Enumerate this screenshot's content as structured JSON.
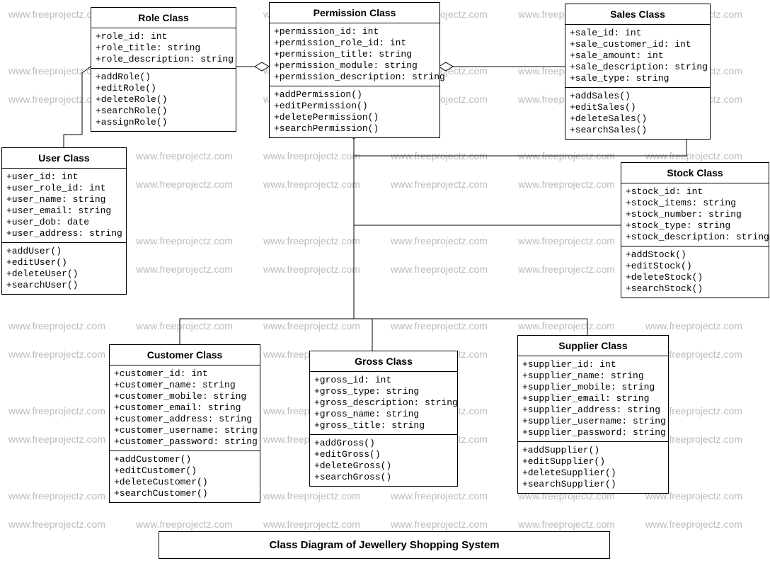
{
  "watermark": "www.freeprojectz.com",
  "caption": "Class Diagram of Jewellery Shopping System",
  "classes": {
    "role": {
      "title": "Role Class",
      "attrs": [
        "+role_id: int",
        "+role_title: string",
        "+role_description: string"
      ],
      "ops": [
        "+addRole()",
        "+editRole()",
        "+deleteRole()",
        "+searchRole()",
        "+assignRole()"
      ]
    },
    "permission": {
      "title": "Permission Class",
      "attrs": [
        "+permission_id: int",
        "+permission_role_id: int",
        "+permission_title: string",
        "+permission_module: string",
        "+permission_description: string"
      ],
      "ops": [
        "+addPermission()",
        "+editPermission()",
        "+deletePermission()",
        "+searchPermission()"
      ]
    },
    "sales": {
      "title": "Sales Class",
      "attrs": [
        "+sale_id: int",
        "+sale_customer_id: int",
        "+sale_amount: int",
        "+sale_description: string",
        "+sale_type: string"
      ],
      "ops": [
        "+addSales()",
        "+editSales()",
        "+deleteSales()",
        "+searchSales()"
      ]
    },
    "user": {
      "title": "User Class",
      "attrs": [
        "+user_id: int",
        "+user_role_id: int",
        "+user_name: string",
        "+user_email: string",
        "+user_dob: date",
        "+user_address: string"
      ],
      "ops": [
        "+addUser()",
        "+editUser()",
        "+deleteUser()",
        "+searchUser()"
      ]
    },
    "stock": {
      "title": "Stock Class",
      "attrs": [
        "+stock_id: int",
        "+stock_items: string",
        "+stock_number: string",
        "+stock_type: string",
        "+stock_description: string"
      ],
      "ops": [
        "+addStock()",
        "+editStock()",
        "+deleteStock()",
        "+searchStock()"
      ]
    },
    "customer": {
      "title": "Customer Class",
      "attrs": [
        "+customer_id: int",
        "+customer_name: string",
        "+customer_mobile: string",
        "+customer_email: string",
        "+customer_address: string",
        "+customer_username: string",
        "+customer_password: string"
      ],
      "ops": [
        "+addCustomer()",
        "+editCustomer()",
        "+deleteCustomer()",
        "+searchCustomer()"
      ]
    },
    "gross": {
      "title": "Gross Class",
      "attrs": [
        "+gross_id: int",
        "+gross_type: string",
        "+gross_description: string",
        "+gross_name: string",
        "+gross_title: string"
      ],
      "ops": [
        "+addGross()",
        "+editGross()",
        "+deleteGross()",
        "+searchGross()"
      ]
    },
    "supplier": {
      "title": "Supplier Class",
      "attrs": [
        "+supplier_id: int",
        "+supplier_name: string",
        "+supplier_mobile: string",
        "+supplier_email: string",
        "+supplier_address: string",
        "+supplier_username: string",
        "+supplier_password: string"
      ],
      "ops": [
        "+addSupplier()",
        "+editSupplier()",
        "+deleteSupplier()",
        "+searchSupplier()"
      ]
    }
  }
}
